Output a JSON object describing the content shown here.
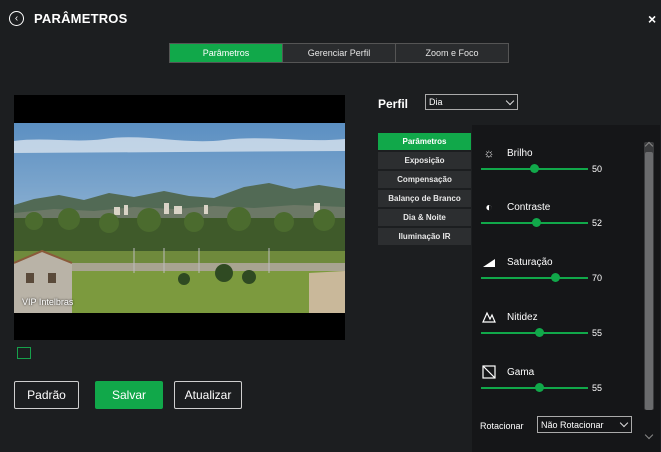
{
  "header": {
    "title": "PARÂMETROS",
    "back_icon": "chevron-left-icon",
    "close_label": "×"
  },
  "top_tabs": [
    {
      "label": "Parâmetros",
      "active": true
    },
    {
      "label": "Gerenciar Perfil",
      "active": false
    },
    {
      "label": "Zoom e Foco",
      "active": false
    }
  ],
  "preview": {
    "overlay_text": "VIP Intelbras"
  },
  "buttons": {
    "default_label": "Padrão",
    "save_label": "Salvar",
    "refresh_label": "Atualizar"
  },
  "profile": {
    "label": "Perfil",
    "selected": "Dia"
  },
  "subnav": [
    {
      "label": "Parâmetros",
      "active": true
    },
    {
      "label": "Exposição",
      "active": false
    },
    {
      "label": "Compensação",
      "active": false
    },
    {
      "label": "Balanço de Branco",
      "active": false
    },
    {
      "label": "Dia & Noite",
      "active": false
    },
    {
      "label": "Iluminação IR",
      "active": false
    }
  ],
  "settings": [
    {
      "label": "Brilho",
      "value": "50",
      "level": 50,
      "icon": "brightness-icon"
    },
    {
      "label": "Contraste",
      "value": "52",
      "level": 52,
      "icon": "contrast-icon"
    },
    {
      "label": "Saturação",
      "value": "70",
      "level": 70,
      "icon": "saturation-icon"
    },
    {
      "label": "Nitidez",
      "value": "55",
      "level": 55,
      "icon": "sharpness-icon"
    },
    {
      "label": "Gama",
      "value": "55",
      "level": 55,
      "icon": "gamma-icon"
    }
  ],
  "rotate": {
    "label": "Rotacionar",
    "selected": "Não Rotacionar"
  },
  "colors": {
    "accent": "#11a84a",
    "background": "#1c1e20",
    "panel": "#151618"
  }
}
